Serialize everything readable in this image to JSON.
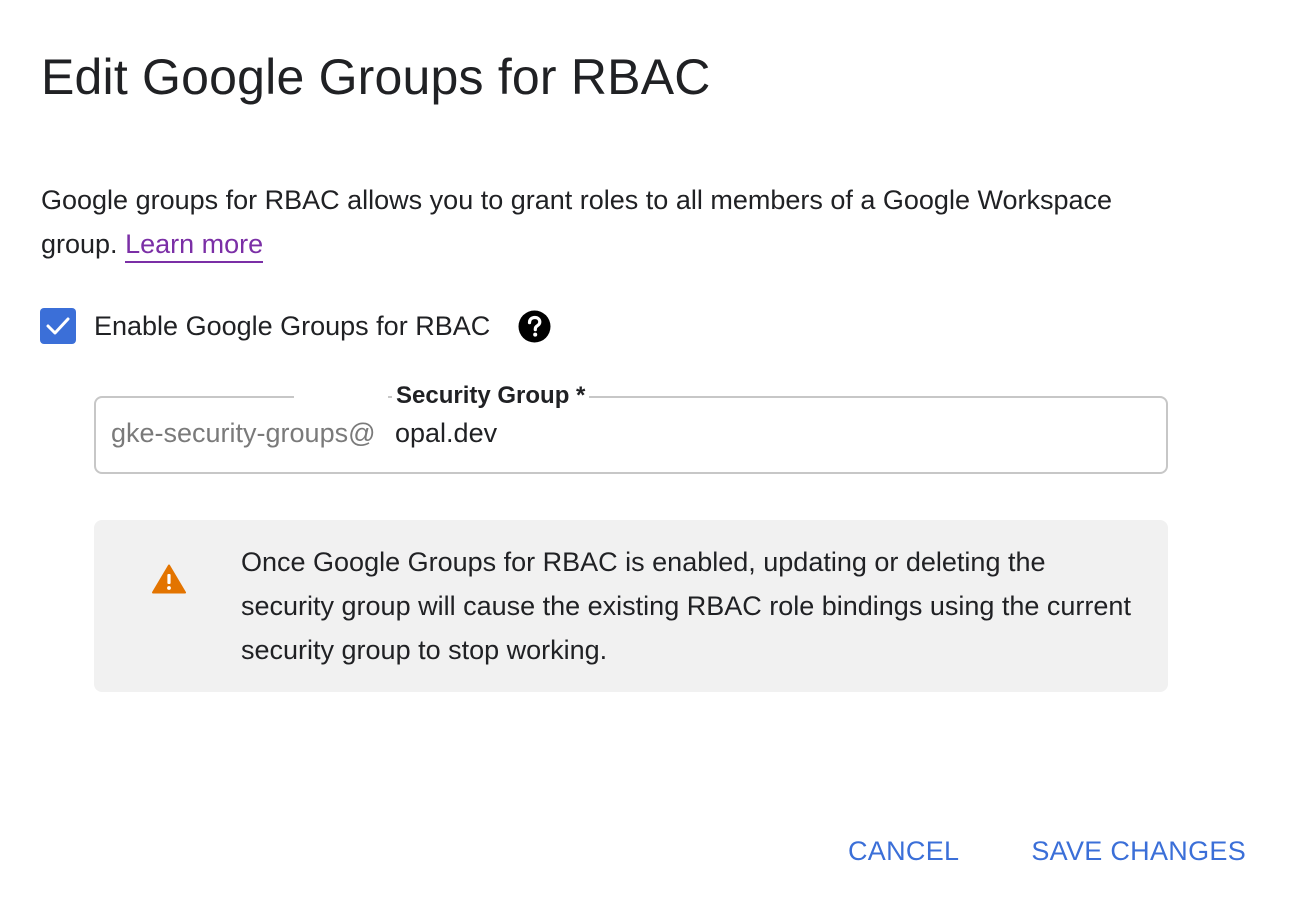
{
  "dialog": {
    "title": "Edit Google Groups for RBAC",
    "description": {
      "text": "Google groups for RBAC allows you to grant roles to all members of a Google Workspace group. ",
      "link_label": "Learn more"
    },
    "enable_checkbox": {
      "label": "Enable Google Groups for RBAC",
      "checked": true,
      "icon": "check-icon"
    },
    "help_icon": "help-circle-icon",
    "security_group_field": {
      "label": "Security Group *",
      "prefix": "gke-security-groups@",
      "value": "opal.dev"
    },
    "warning": {
      "icon": "warning-icon",
      "text": "Once Google Groups for RBAC is enabled, updating or deleting the security group will cause the existing RBAC role bindings using the current security group to stop working."
    },
    "actions": {
      "cancel_label": "CANCEL",
      "save_label": "SAVE CHANGES"
    }
  },
  "colors": {
    "accent": "#3b6fd8",
    "link": "#7b2fa6",
    "warning_icon": "#e37400",
    "warning_background": "#f1f1f1"
  }
}
